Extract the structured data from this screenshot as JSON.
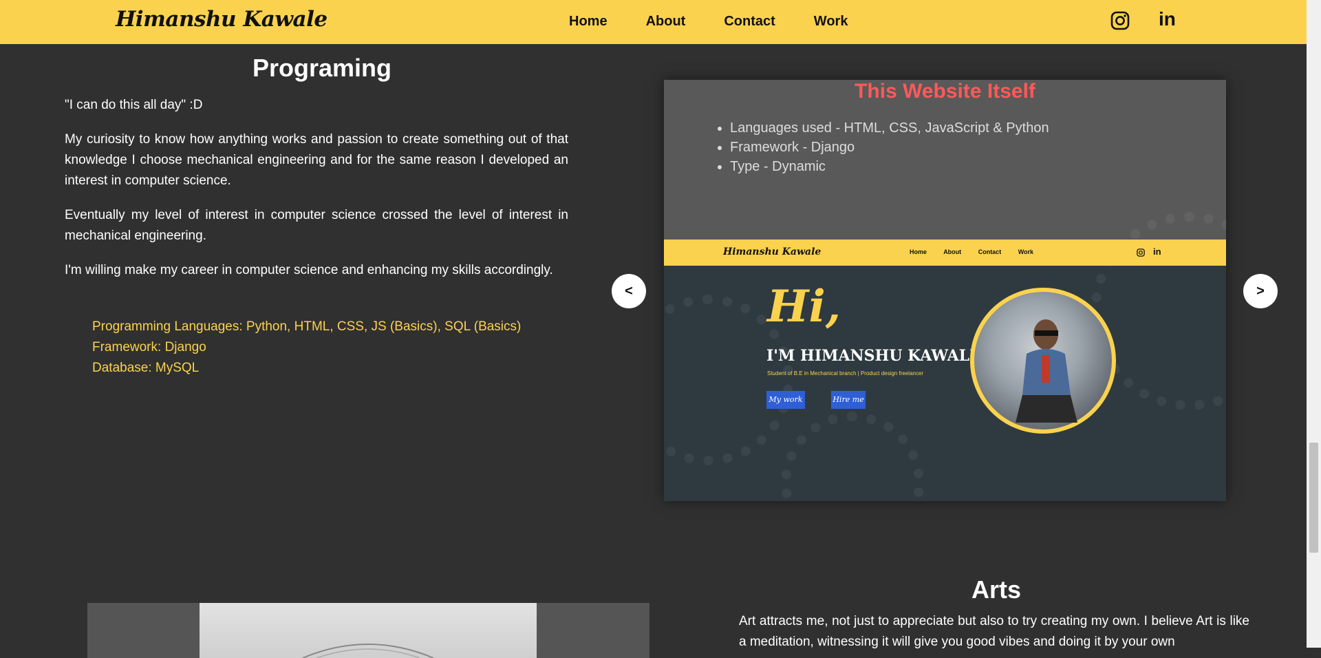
{
  "nav": {
    "brand": "Himanshu Kawale",
    "links": [
      "Home",
      "About",
      "Contact",
      "Work"
    ],
    "social": {
      "instagram_icon": "instagram-icon",
      "linkedin_label": "in"
    }
  },
  "programming": {
    "title": "Programing",
    "quote": "\"I can do this all day\" :D",
    "paragraphs": [
      "My curiosity to know how anything works and passion to create something out of that knowledge I choose mechanical engineering and for the same reason I developed an interest in computer science.",
      "Eventually my level of interest in computer science crossed the level of interest in mechanical engineering.",
      "I'm willing make my career in computer science and enhancing my skills accordingly."
    ],
    "skills": [
      "Programming Languages: Python, HTML, CSS, JS (Basics), SQL (Basics)",
      "Framework: Django",
      "Database: MySQL"
    ]
  },
  "carousel": {
    "prev_label": "<",
    "next_label": ">",
    "slide": {
      "title": "This Website Itself",
      "bullets": [
        "Languages used - HTML, CSS, JavaScript & Python",
        "Framework - Django",
        "Type - Dynamic"
      ],
      "preview": {
        "brand": "Himanshu Kawale",
        "links": [
          "Home",
          "About",
          "Contact",
          "Work"
        ],
        "linkedin_label": "in",
        "hi": "Hi,",
        "name": "I'M HIMANSHU KAWALE",
        "subtitle": "Student of B.E in Mechanical branch | Product design freelancer",
        "btn_work": "My work",
        "btn_hire": "Hire me"
      }
    }
  },
  "arts": {
    "title": "Arts",
    "text": "Art attracts me, not just to appreciate but also to try creating my own. I believe Art is like a meditation, witnessing it will give you good vibes and doing it by your own"
  },
  "colors": {
    "accent": "#fbd24e",
    "background": "#303030",
    "slide_title": "#ff5959",
    "button": "#2f5fd6"
  }
}
